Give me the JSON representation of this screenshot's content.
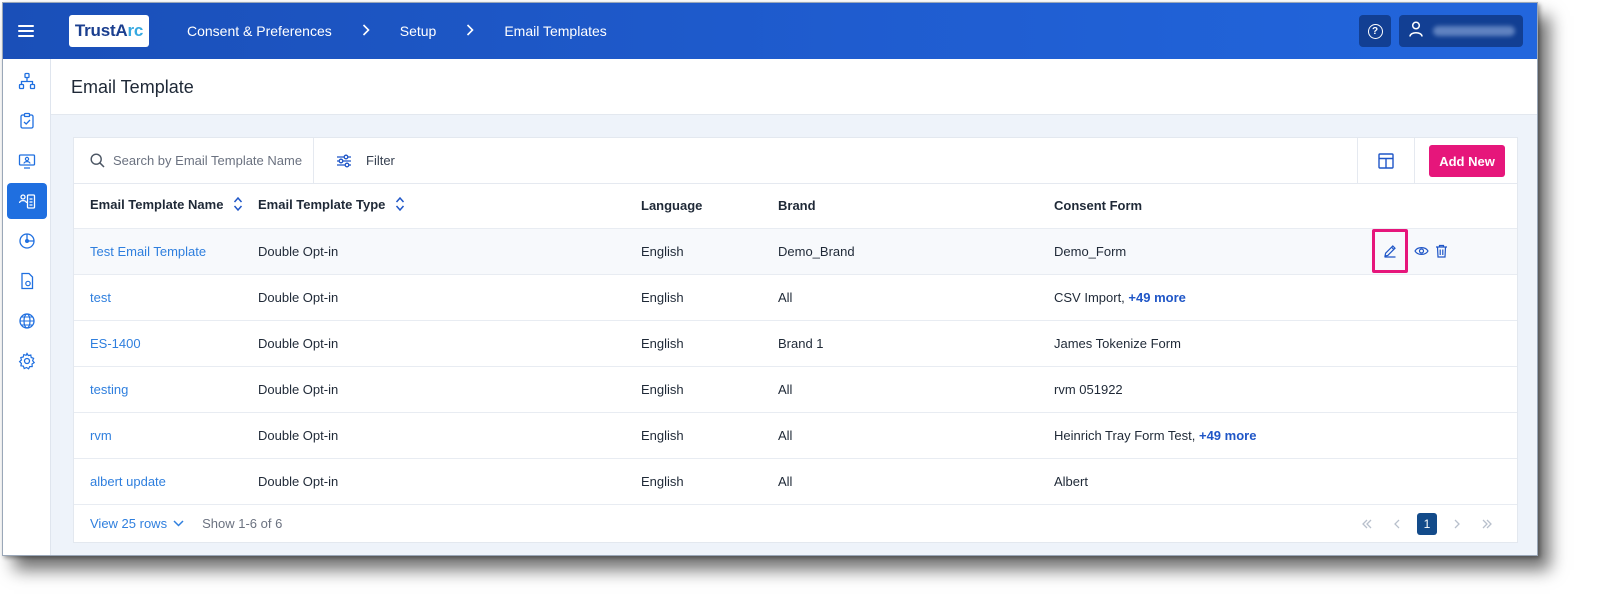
{
  "header": {
    "logo_text_main": "TrustA",
    "logo_text_arc": "rc",
    "breadcrumb": [
      "Consent & Preferences",
      "Setup",
      "Email Templates"
    ],
    "colors": {
      "header_start": "#1a4fb8",
      "header_end": "#2266dd",
      "accent_pink": "#e6167b",
      "link": "#2f7fde"
    }
  },
  "sidebar": {
    "items": [
      {
        "icon": "network-icon"
      },
      {
        "icon": "clipboard-check-icon"
      },
      {
        "icon": "monitor-user-icon"
      },
      {
        "icon": "contact-list-icon",
        "active": true
      },
      {
        "icon": "analytics-icon"
      },
      {
        "icon": "document-settings-icon"
      },
      {
        "icon": "globe-icon"
      },
      {
        "icon": "gear-icon"
      }
    ]
  },
  "page": {
    "title": "Email Template"
  },
  "toolbar": {
    "search_placeholder": "Search by Email Template Name",
    "filter_label": "Filter",
    "add_new_label": "Add New"
  },
  "table": {
    "columns": [
      "Email Template Name",
      "Email Template Type",
      "Language",
      "Brand",
      "Consent Form"
    ],
    "rows": [
      {
        "name": "Test Email Template",
        "type": "Double Opt-in",
        "language": "English",
        "brand": "Demo_Brand",
        "form": "Demo_Form",
        "more": ""
      },
      {
        "name": "test",
        "type": "Double Opt-in",
        "language": "English",
        "brand": "All",
        "form": "CSV Import,",
        "more": "+49 more"
      },
      {
        "name": "ES-1400",
        "type": "Double Opt-in",
        "language": "English",
        "brand": "Brand 1",
        "form": "James Tokenize Form",
        "more": ""
      },
      {
        "name": "testing",
        "type": "Double Opt-in",
        "language": "English",
        "brand": "All",
        "form": "rvm 051922",
        "more": ""
      },
      {
        "name": "rvm",
        "type": "Double Opt-in",
        "language": "English",
        "brand": "All",
        "form": "Heinrich Tray Form Test,",
        "more": "+49 more"
      },
      {
        "name": "albert update",
        "type": "Double Opt-in",
        "language": "English",
        "brand": "All",
        "form": "Albert",
        "more": ""
      }
    ]
  },
  "footer": {
    "view_rows_label": "View 25 rows",
    "show_count": "Show 1-6 of 6",
    "current_page": "1"
  }
}
